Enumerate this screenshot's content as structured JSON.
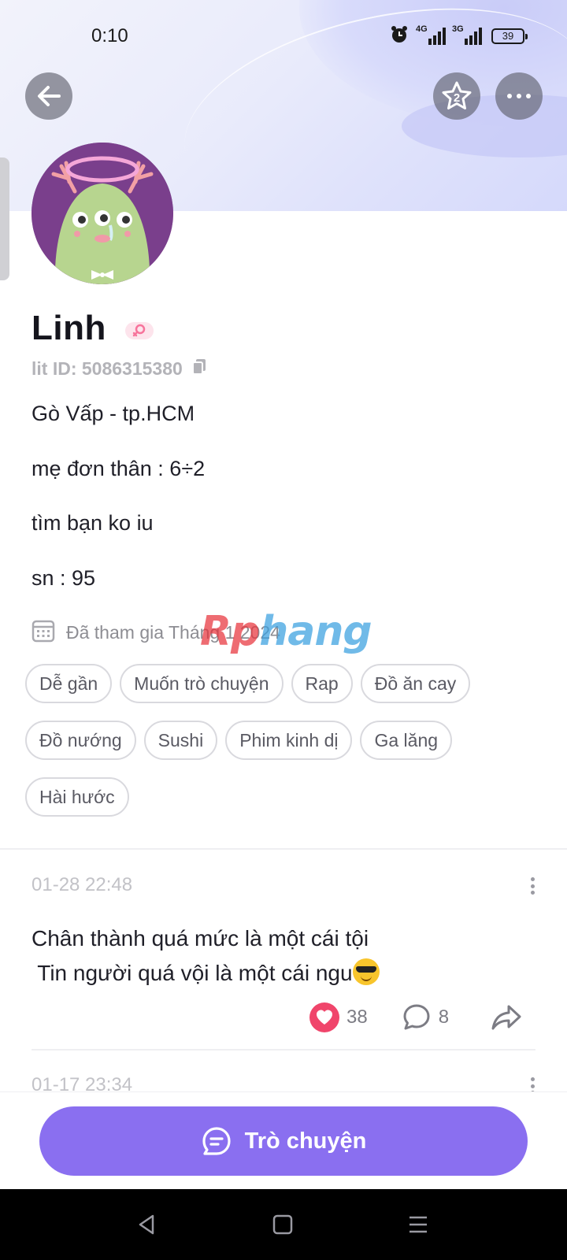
{
  "status_bar": {
    "time": "0:10",
    "network_1": "4G",
    "network_2": "3G",
    "battery": "39"
  },
  "header": {
    "back_icon": "arrow-left-icon",
    "favorite_badge": "2",
    "more_icon": "more-horizontal-icon"
  },
  "profile": {
    "name": "Linh",
    "gender_icon": "female-icon",
    "gender_color": "#f7739b",
    "lit_id": "lit ID: 5086315380",
    "bio_lines": [
      "Gò Vấp - tp.HCM",
      "mẹ đơn thân : 6÷2",
      "tìm bạn ko iu",
      "sn : 95"
    ],
    "joined": "Đã tham gia Tháng 1 2024",
    "tags": [
      "Dễ gần",
      "Muốn trò chuyện",
      "Rap",
      "Đồ ăn cay",
      "Đồ nướng",
      "Sushi",
      "Phim kinh dị",
      "Ga lăng",
      "Hài hước"
    ]
  },
  "watermark": {
    "part1": "Rp",
    "part2": "hang"
  },
  "posts": [
    {
      "time": "01-28 22:48",
      "lines": [
        "Chân thành quá mức là một cái tội",
        " Tin người quá vội là một cái ngu"
      ],
      "emoji": "sunglasses-emoji",
      "likes": "38",
      "comments": "8"
    },
    {
      "time": "01-17 23:34"
    }
  ],
  "chat_button": {
    "label": "Trò chuyện"
  },
  "colors": {
    "accent": "#8a6ff0",
    "like": "#f0456b"
  }
}
